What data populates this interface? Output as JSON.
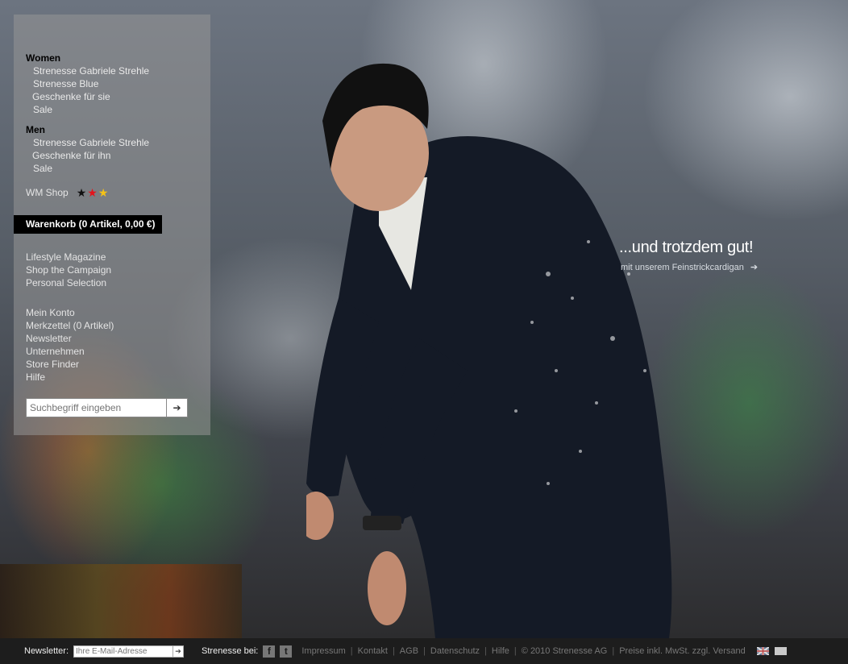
{
  "sidebar": {
    "women": {
      "heading": "Women",
      "items": [
        "Strenesse Gabriele Strehle",
        "Strenesse Blue",
        "Geschenke für sie",
        "Sale"
      ]
    },
    "men": {
      "heading": "Men",
      "items": [
        "Strenesse Gabriele Strehle",
        "Geschenke für ihn",
        "Sale"
      ]
    },
    "wm_shop": {
      "label": "WM Shop",
      "star_colors": [
        "#111111",
        "#e4131b",
        "#f5c216"
      ]
    },
    "cart_label": "Warenkorb (0 Artikel, 0,00 €)",
    "campaign_links": [
      "Lifestyle Magazine",
      "Shop the Campaign",
      "Personal Selection"
    ],
    "account_links": [
      "Mein Konto",
      "Merkzettel (0 Artikel)",
      "Newsletter",
      "Unternehmen",
      "Store Finder",
      "Hilfe"
    ],
    "search": {
      "placeholder": "Suchbegriff eingeben",
      "submit_icon": "arrow-right-icon"
    }
  },
  "hero": {
    "headline": "...und trotzdem gut!",
    "subline": "mit unserem Feinstrickcardigan"
  },
  "footer": {
    "newsletter_label": "Newsletter:",
    "newsletter_placeholder": "Ihre E-Mail-Adresse",
    "social_label": "Strenesse bei:",
    "social_icons": [
      "facebook-icon",
      "twitter-icon"
    ],
    "links": [
      "Impressum",
      "Kontakt",
      "AGB",
      "Datenschutz",
      "Hilfe",
      "© 2010 Strenesse AG",
      "Preise inkl. MwSt. zzgl. Versand"
    ]
  }
}
